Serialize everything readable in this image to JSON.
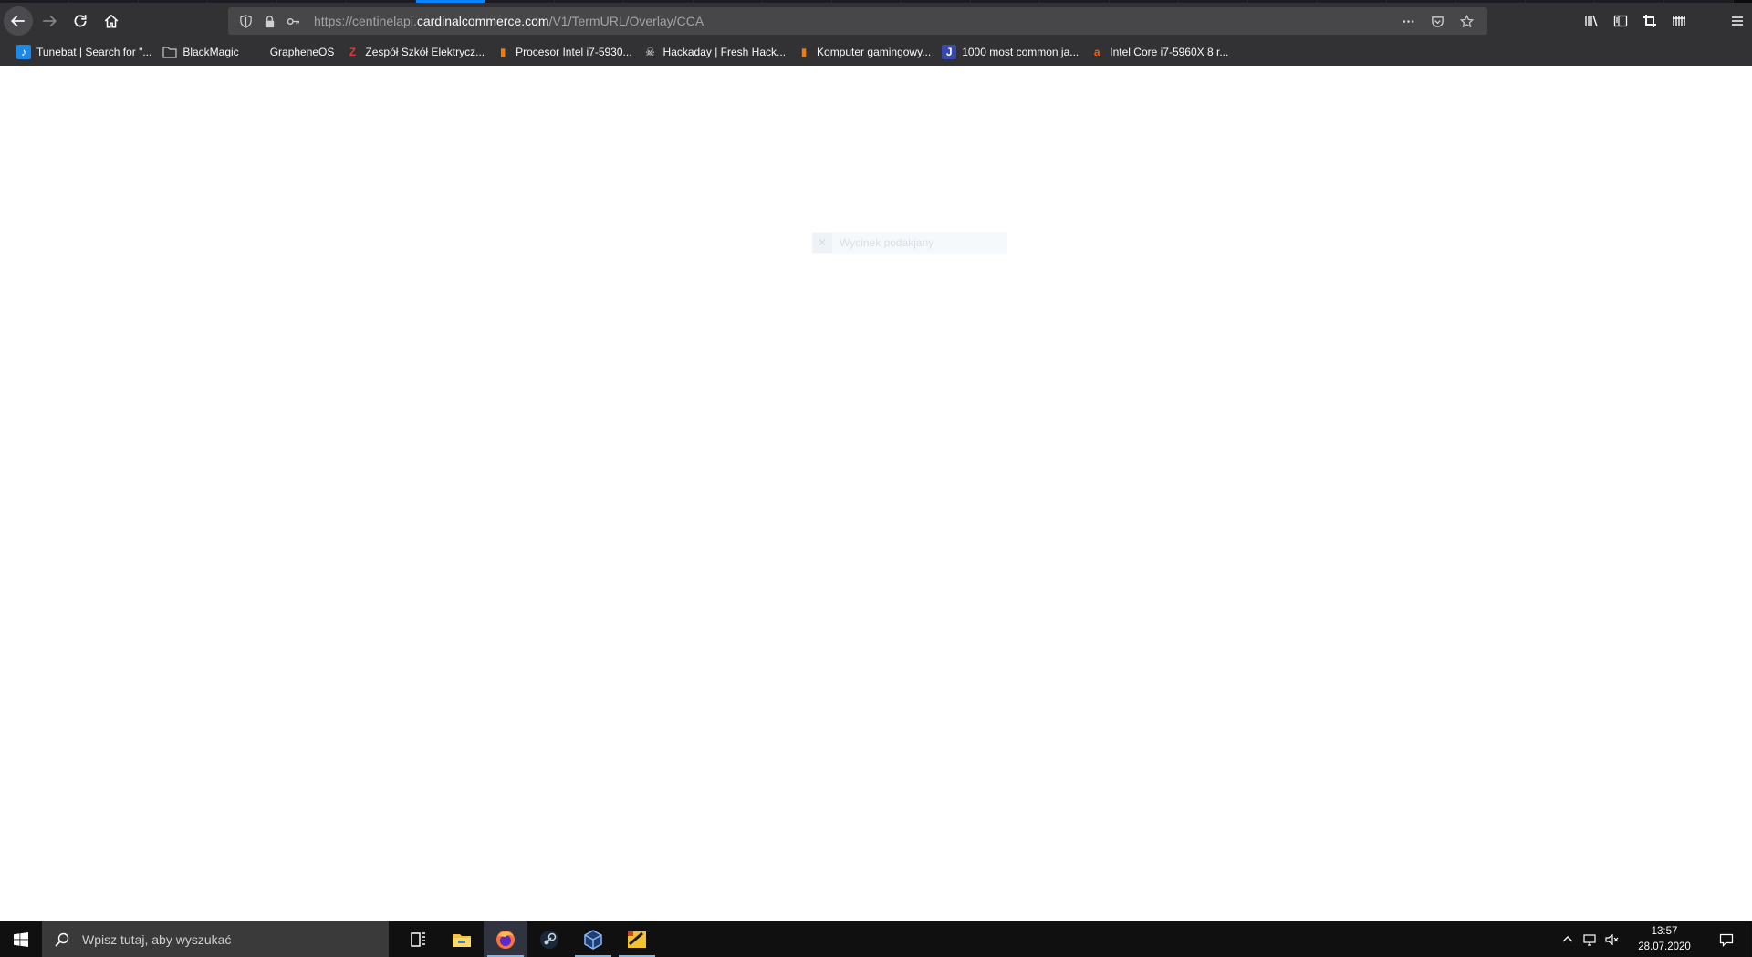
{
  "browser": {
    "tab_count": 25,
    "active_tab_index": 6,
    "url": {
      "prefix": "https://centinelapi.",
      "host": "cardinalcommerce.com",
      "path": "/V1/TermURL/Overlay/CCA"
    }
  },
  "bookmarks": [
    {
      "label": "Tunebat | Search for \"...",
      "icon": "tunebat-icon",
      "color": "#1e88e5",
      "glyph": "♪"
    },
    {
      "label": "BlackMagic",
      "icon": "folder-icon",
      "color": "#c8c8c8",
      "glyph": ""
    },
    {
      "label": "GrapheneOS",
      "icon": "grapheneos-icon",
      "color": "#333333",
      "glyph": "⁂"
    },
    {
      "label": "Zespół Szkół Elektrycz...",
      "icon": "zse-icon",
      "color": "#e53935",
      "glyph": "Z"
    },
    {
      "label": "Procesor Intel i7-5930...",
      "icon": "ceneo-icon",
      "color": "#f57c00",
      "glyph": "▮"
    },
    {
      "label": "Hackaday | Fresh Hack...",
      "icon": "hackaday-icon",
      "color": "#f9f9fa",
      "glyph": "☠"
    },
    {
      "label": "Komputer gamingowy...",
      "icon": "ceneo-icon",
      "color": "#f57c00",
      "glyph": "▮"
    },
    {
      "label": "1000 most common ja...",
      "icon": "j-icon",
      "color": "#3949ab",
      "glyph": "J"
    },
    {
      "label": "Intel Core i7-5960X 8 r...",
      "icon": "allegro-icon",
      "color": "#ff5a00",
      "glyph": "a"
    }
  ],
  "content": {
    "broken_image_alt": "Wycinek podakjany"
  },
  "taskbar": {
    "search_placeholder": "Wpisz tutaj, aby wyszukać",
    "apps": [
      {
        "name": "task-view",
        "state": "pinned"
      },
      {
        "name": "file-explorer",
        "state": "pinned"
      },
      {
        "name": "firefox",
        "state": "active"
      },
      {
        "name": "steam",
        "state": "pinned"
      },
      {
        "name": "virtualbox",
        "state": "open"
      },
      {
        "name": "app-yellow",
        "state": "open"
      }
    ],
    "clock": {
      "time": "13:57",
      "date": "28.07.2020"
    }
  },
  "colors": {
    "toolbar": "#323234",
    "urlbar": "#474749",
    "taskbar": "#101010",
    "accent": "#0a84ff"
  }
}
